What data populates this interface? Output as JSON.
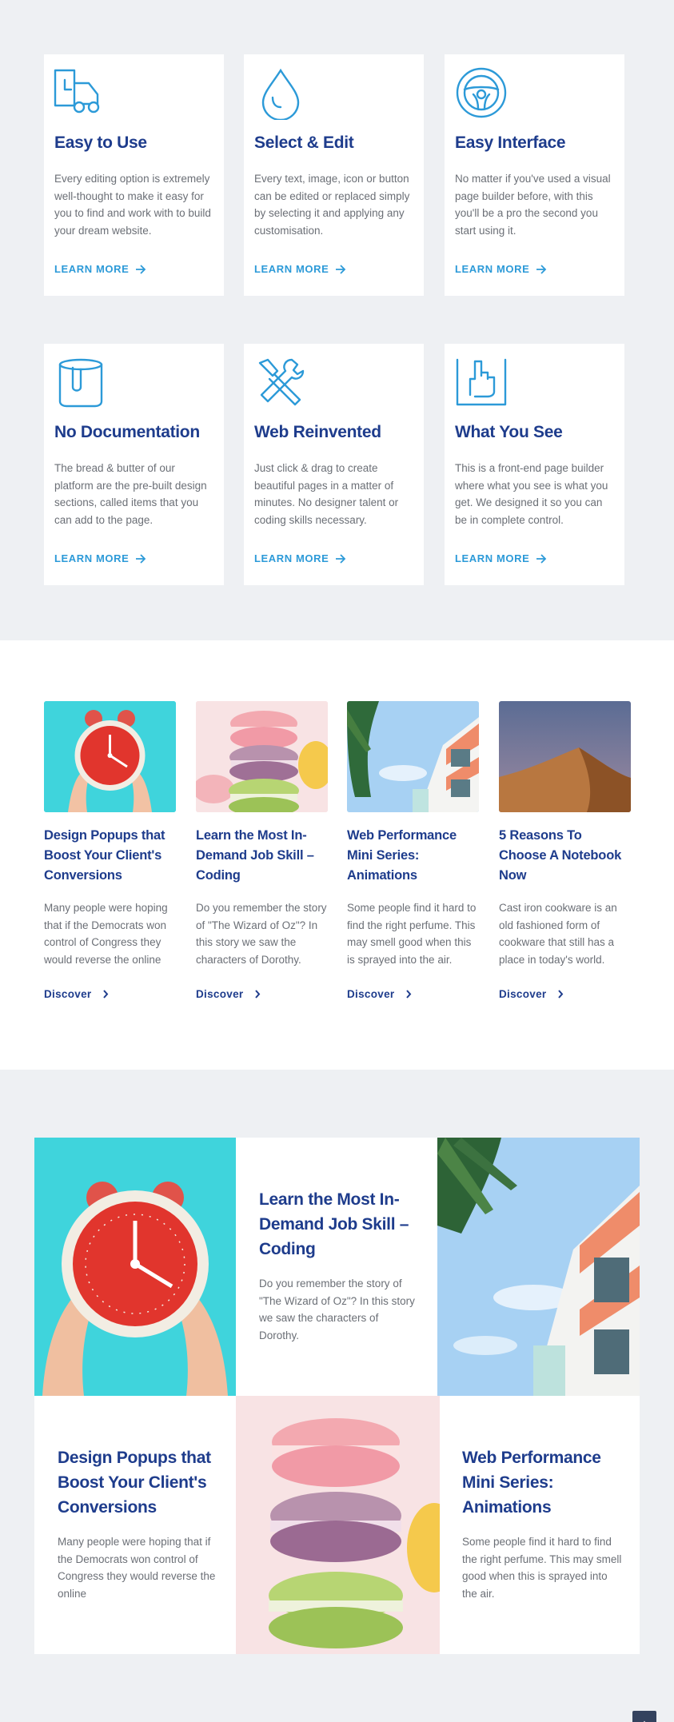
{
  "features": [
    {
      "title": "Easy to Use",
      "text": "Every editing option is extremely well-thought to make it easy for you to find and work with to build your dream website.",
      "more": "LEARN MORE",
      "icon": "truck-icon"
    },
    {
      "title": "Select & Edit",
      "text": "Every text, image, icon or button can be edited or replaced simply by selecting it and applying any customisation.",
      "more": "LEARN MORE",
      "icon": "drop-icon"
    },
    {
      "title": "Easy Interface",
      "text": "No matter if you've used a visual page builder before, with this you'll be a pro the second you start using it.",
      "more": "LEARN MORE",
      "icon": "steering-wheel-icon"
    },
    {
      "title": "No Documentation",
      "text": "The bread & butter of our platform are the pre-built design sections, called items that you can add to the page.",
      "more": "LEARN MORE",
      "icon": "cup-icon"
    },
    {
      "title": "Web Reinvented",
      "text": "Just click & drag to create beautiful pages in a matter of minutes. No designer talent or coding skills necessary.",
      "more": "LEARN MORE",
      "icon": "tools-icon"
    },
    {
      "title": "What You See",
      "text": "This is a front-end page builder where what you see is what you get. We designed it so you can be in complete control.",
      "more": "LEARN MORE",
      "icon": "hand-drag-icon"
    }
  ],
  "posts": [
    {
      "title": "Design Popups that Boost Your Client's Conversions",
      "text": "Many people were hoping that if the Democrats won control of Congress they would reverse the online",
      "link": "Discover",
      "image": "alarm-clock"
    },
    {
      "title": "Learn the Most In-Demand Job Skill – Coding",
      "text": "Do you remember the story of \"The Wizard of Oz\"? In this story we saw the characters of Dorothy.",
      "link": "Discover",
      "image": "macarons"
    },
    {
      "title": "Web Performance Mini Series: Animations",
      "text": "Some people find it hard to find the right perfume. This may smell good when this is sprayed into the air.",
      "link": "Discover",
      "image": "building-palm"
    },
    {
      "title": "5 Reasons To Choose A Notebook Now",
      "text": "Cast iron cookware is an old fashioned form of cookware that still has a place in today's world.",
      "link": "Discover",
      "image": "desert-dune"
    }
  ],
  "mosaic": {
    "top_text": {
      "title": "Learn the Most In-Demand Job Skill – Coding",
      "text": "Do you remember the story of \"The Wizard of Oz\"? In this story we saw the characters of Dorothy."
    },
    "bottom_left": {
      "title": "Design Popups that Boost Your Client's Conversions",
      "text": "Many people were hoping that if the Democrats won control of Congress they would reverse the online"
    },
    "bottom_right": {
      "title": "Web Performance Mini Series: Animations",
      "text": "Some people find it hard to find the right perfume. This may smell good when this is sprayed into the air."
    }
  },
  "colors": {
    "heading": "#1e3c8c",
    "accent": "#2c9ad8",
    "body": "#6b6f76",
    "bg": "#eef0f3"
  },
  "back_to_top": "↑"
}
